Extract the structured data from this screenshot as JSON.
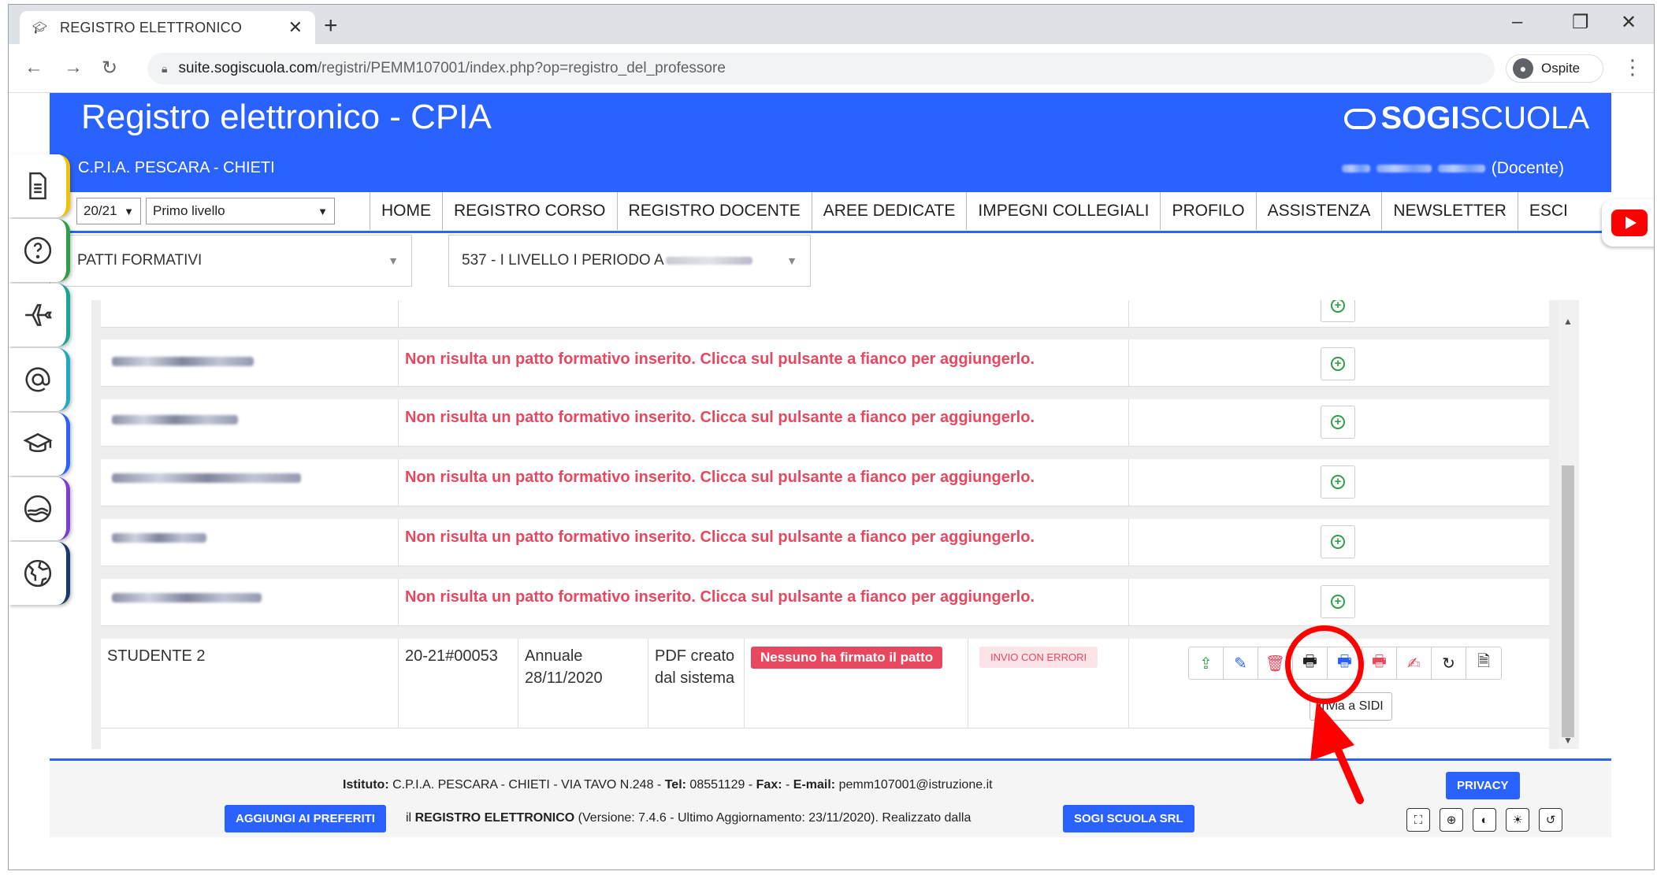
{
  "browser": {
    "tab_title": "REGISTRO ELETTRONICO",
    "url_host": "suite.sogiscuola.com",
    "url_path": "/registri/PEMM107001/index.php?op=registro_del_professore",
    "profile_label": "Ospite"
  },
  "header": {
    "title": "Registro elettronico - CPIA",
    "brand_bold": "SOGI",
    "brand_light": "SCUOLA",
    "school": "C.P.I.A. PESCARA - CHIETI",
    "role": "(Docente)"
  },
  "nav": {
    "year_select": "20/21",
    "level_select": "Primo livello",
    "items": [
      "HOME",
      "REGISTRO CORSO",
      "REGISTRO DOCENTE",
      "AREE DEDICATE",
      "IMPEGNI COLLEGIALI",
      "PROFILO",
      "ASSISTENZA",
      "NEWSLETTER",
      "ESCI"
    ]
  },
  "filters": {
    "section": "PATTI FORMATIVI",
    "class": "537 - I LIVELLO I PERIODO A"
  },
  "table": {
    "empty_message": "Non risulta un patto formativo inserito. Clicca sul pulsante a fianco per aggiungerlo.",
    "student_row": {
      "name": "STUDENTE 2",
      "code": "20-21#00053",
      "type_line1": "Annuale",
      "type_line2": "28/11/2020",
      "pdf_line1": "PDF creato",
      "pdf_line2": "dal sistema",
      "sign_status": "Nessuno ha firmato il patto",
      "send_status": "INVIO CON ERRORI",
      "tooltip": "Invia a SIDI"
    }
  },
  "footer": {
    "istituto_label": "Istituto:",
    "istituto_value": "C.P.I.A. PESCARA - CHIETI - VIA TAVO N.248 - ",
    "tel_label": "Tel:",
    "tel_value": "08551129 - ",
    "fax_label": "Fax:",
    "fax_value": " - ",
    "email_label": "E-mail:",
    "email_value": "pemm107001@istruzione.it",
    "privacy_button": "PRIVACY",
    "favorites_button": "AGGIUNGI AI PREFERITI",
    "app_prefix": "il ",
    "app_name": "REGISTRO ELETTRONICO",
    "version_text": " (Versione: 7.4.6 - Ultimo Aggiornamento: 23/11/2020). Realizzato dalla",
    "vendor_button": "SOGI SCUOLA SRL"
  },
  "colors": {
    "primary": "#2962ff",
    "error": "#e8485f",
    "success": "#2e9e48",
    "annotation": "#ff0000"
  }
}
